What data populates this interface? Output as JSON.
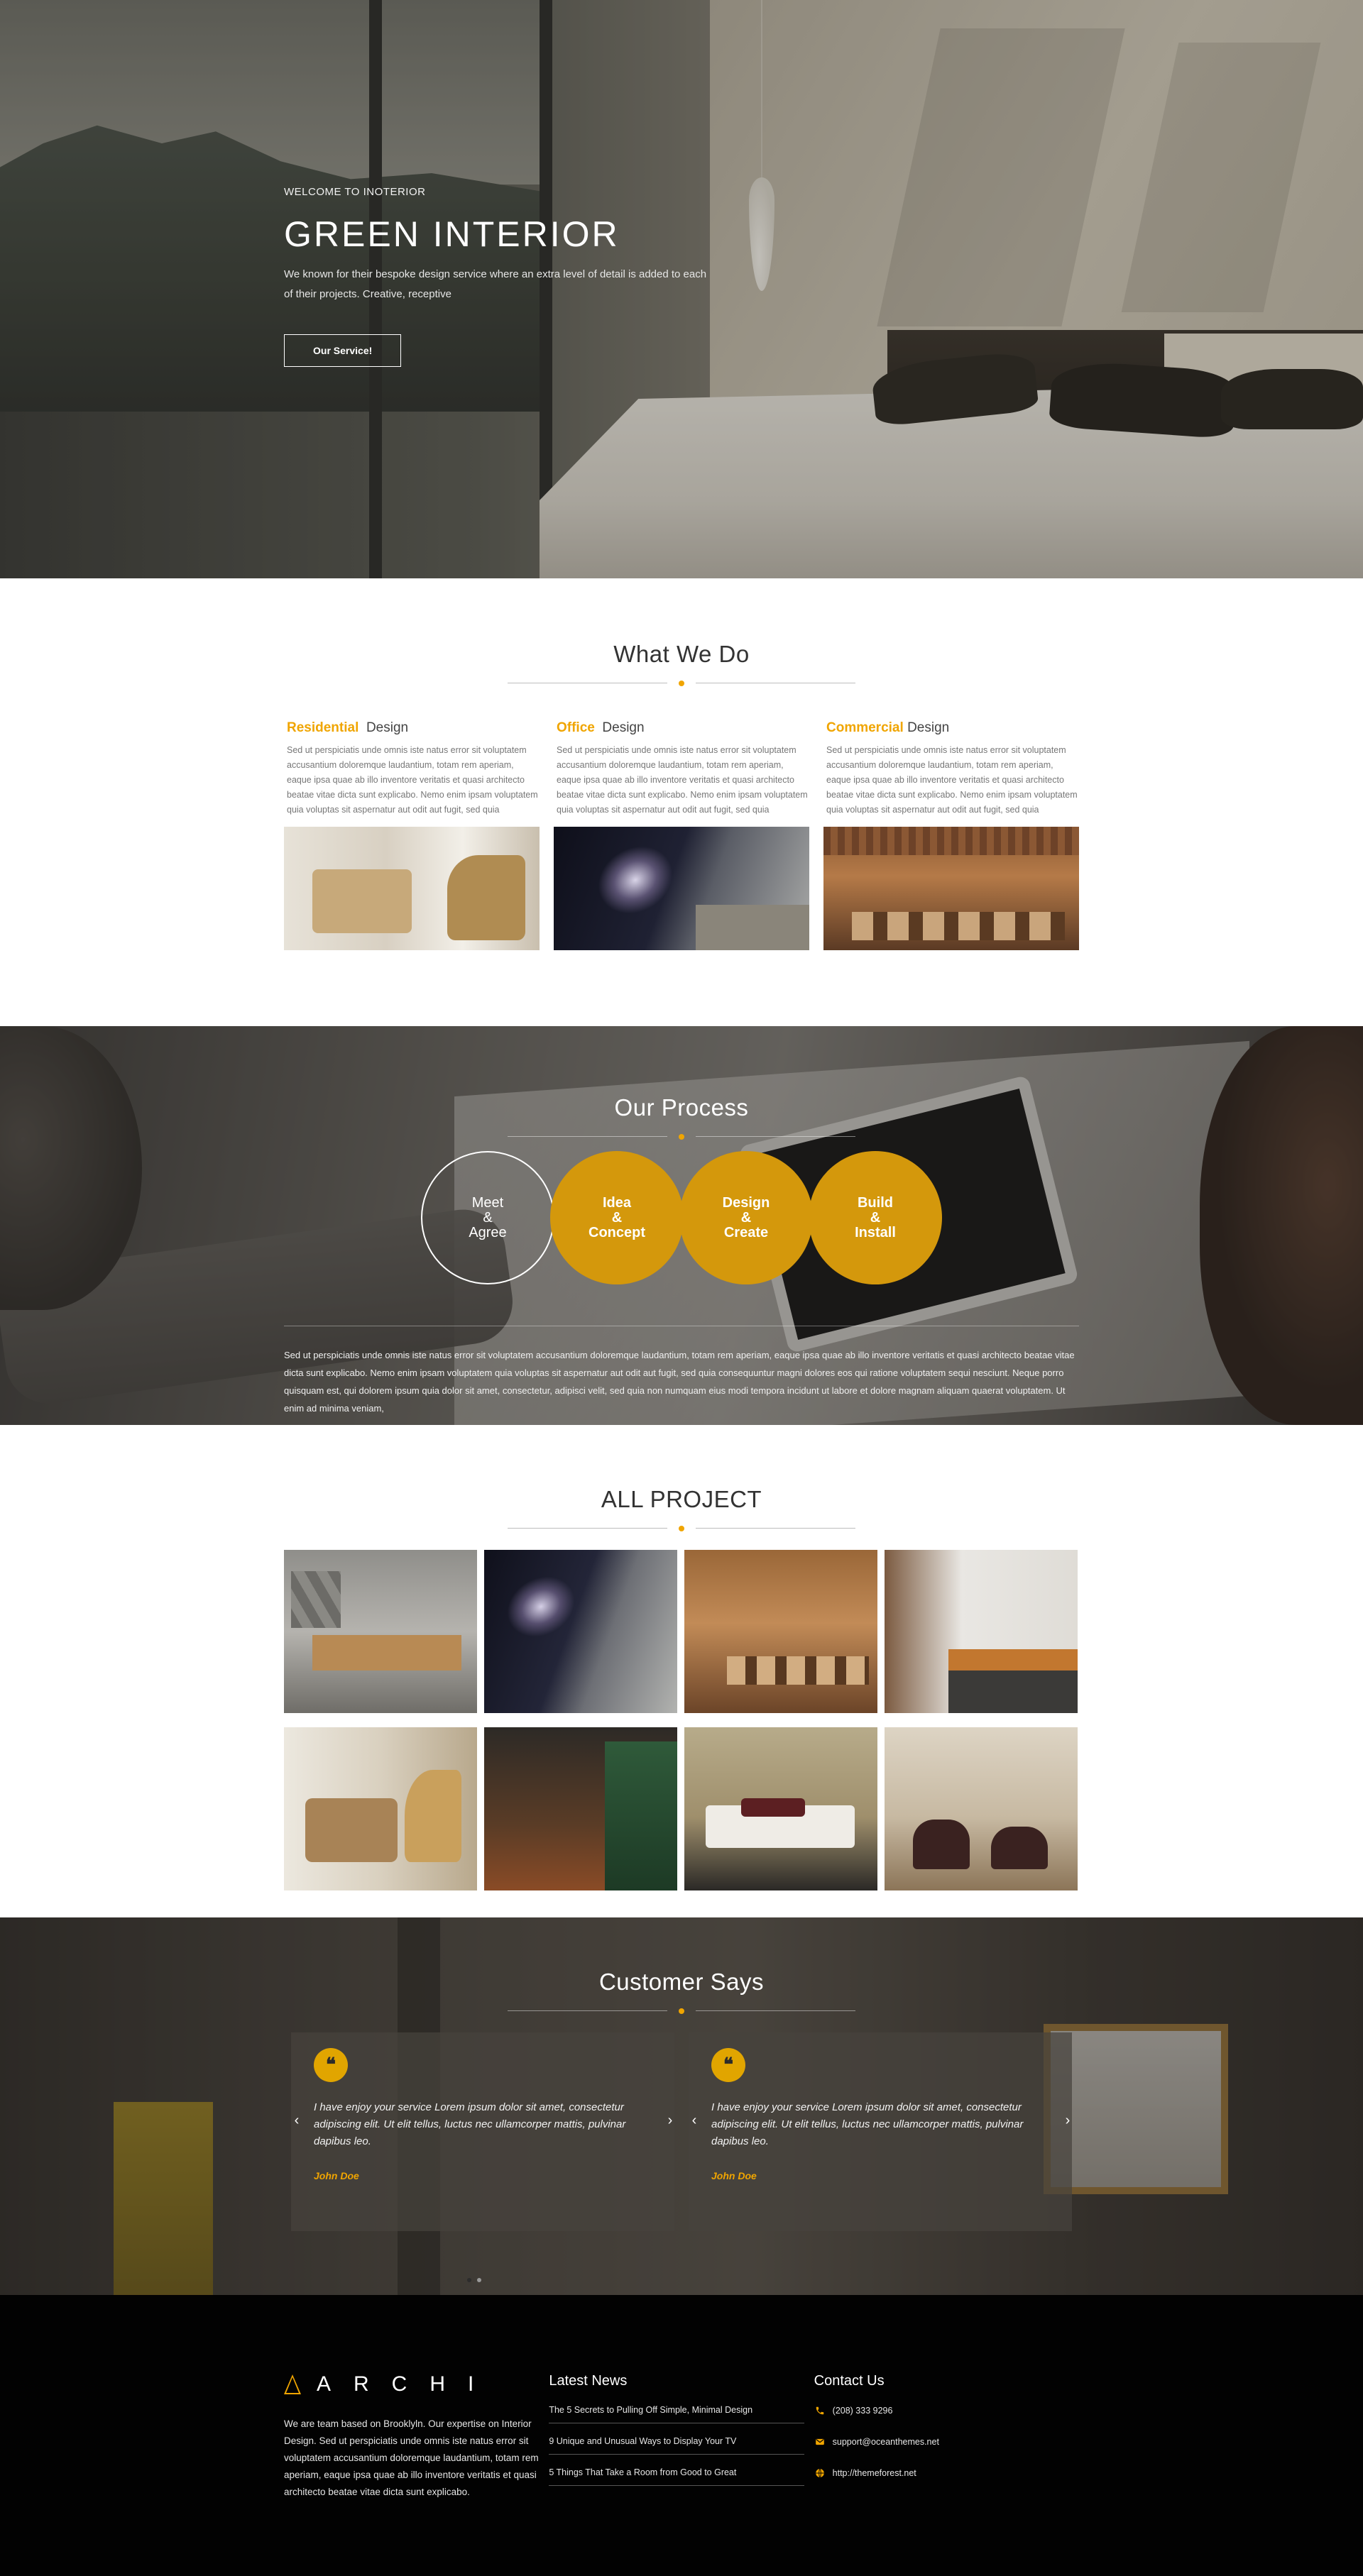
{
  "hero": {
    "eyebrow": "WELCOME TO INOTERIOR",
    "title": "GREEN INTERIOR",
    "description": "We known for their bespoke design service where an extra level of detail is added to each of their projects. Creative, receptive",
    "button_label": "Our Service!"
  },
  "what_we_do": {
    "title": "What We Do",
    "services": [
      {
        "highlight": "Residential",
        "rest": "Design",
        "text": "Sed ut perspiciatis unde omnis iste natus error sit voluptatem accusantium doloremque laudantium, totam rem aperiam, eaque ipsa quae ab illo inventore veritatis et quasi architecto beatae vitae dicta sunt explicabo. Nemo enim ipsam voluptatem quia voluptas sit aspernatur aut odit aut fugit, sed quia"
      },
      {
        "highlight": "Office",
        "rest": "Design",
        "text": "Sed ut perspiciatis unde omnis iste natus error sit voluptatem accusantium doloremque laudantium, totam rem aperiam, eaque ipsa quae ab illo inventore veritatis et quasi architecto beatae vitae dicta sunt explicabo. Nemo enim ipsam voluptatem quia voluptas sit aspernatur aut odit aut fugit, sed quia"
      },
      {
        "highlight": "Commercial",
        "rest": "Design",
        "text": "Sed ut perspiciatis unde omnis iste natus error sit voluptatem accusantium doloremque laudantium, totam rem aperiam, eaque ipsa quae ab illo inventore veritatis et quasi architecto beatae vitae dicta sunt explicabo. Nemo enim ipsam voluptatem quia voluptas sit aspernatur aut odit aut fugit, sed quia"
      }
    ]
  },
  "process": {
    "title": "Our Process",
    "steps": [
      "Meet\n&\nAgree",
      "Idea\n&\nConcept",
      "Design\n&\nCreate",
      "Build\n&\nInstall"
    ],
    "text": "Sed ut perspiciatis unde omnis iste natus error sit voluptatem accusantium doloremque laudantium, totam rem aperiam, eaque ipsa quae ab illo inventore veritatis et quasi architecto beatae vitae dicta sunt explicabo. Nemo enim ipsam voluptatem quia voluptas sit aspernatur aut odit aut fugit, sed quia consequuntur magni dolores eos qui ratione voluptatem sequi nesciunt. Neque porro quisquam est, qui dolorem ipsum quia dolor sit amet, consectetur, adipisci velit, sed quia non numquam eius modi tempora incidunt ut labore et dolore magnam aliquam quaerat voluptatem. Ut enim ad minima veniam,"
  },
  "projects": {
    "title": "ALL PROJECT"
  },
  "customers": {
    "title": "Customer Says",
    "quote_icon": "quote-icon",
    "testimonials": [
      {
        "text": "I have enjoy your service Lorem ipsum dolor sit amet, consectetur adipiscing elit. Ut elit tellus, luctus nec ullamcorper mattis, pulvinar dapibus leo.",
        "author": "John Doe"
      },
      {
        "text": "I have enjoy your service Lorem ipsum dolor sit amet, consectetur adipiscing elit. Ut elit tellus, luctus nec ullamcorper mattis, pulvinar dapibus leo.",
        "author": "John Doe"
      }
    ]
  },
  "footer": {
    "logo_text": "ARCHI",
    "about": "We are team based on Brooklyln. Our expertise on Interior Design. Sed ut perspiciatis unde omnis iste natus error sit voluptatem accusantium doloremque laudantium, totam rem aperiam, eaque ipsa quae ab illo inventore veritatis et quasi architecto beatae vitae dicta sunt explicabo.",
    "news_title": "Latest News",
    "news": [
      "The 5 Secrets to Pulling Off Simple, Minimal Design",
      "9 Unique and Unusual Ways to Display Your TV",
      "5 Things That Take a Room from Good to Great"
    ],
    "contact_title": "Contact Us",
    "contacts": [
      {
        "icon": "phone-icon",
        "text": "(208) 333 9296"
      },
      {
        "icon": "envelope-icon",
        "text": "support@oceanthemes.net"
      },
      {
        "icon": "globe-icon",
        "text": "http://themeforest.net"
      }
    ]
  },
  "colors": {
    "accent": "#f0a500",
    "process_fill": "#d4980c",
    "footer_bg": "#020202"
  }
}
